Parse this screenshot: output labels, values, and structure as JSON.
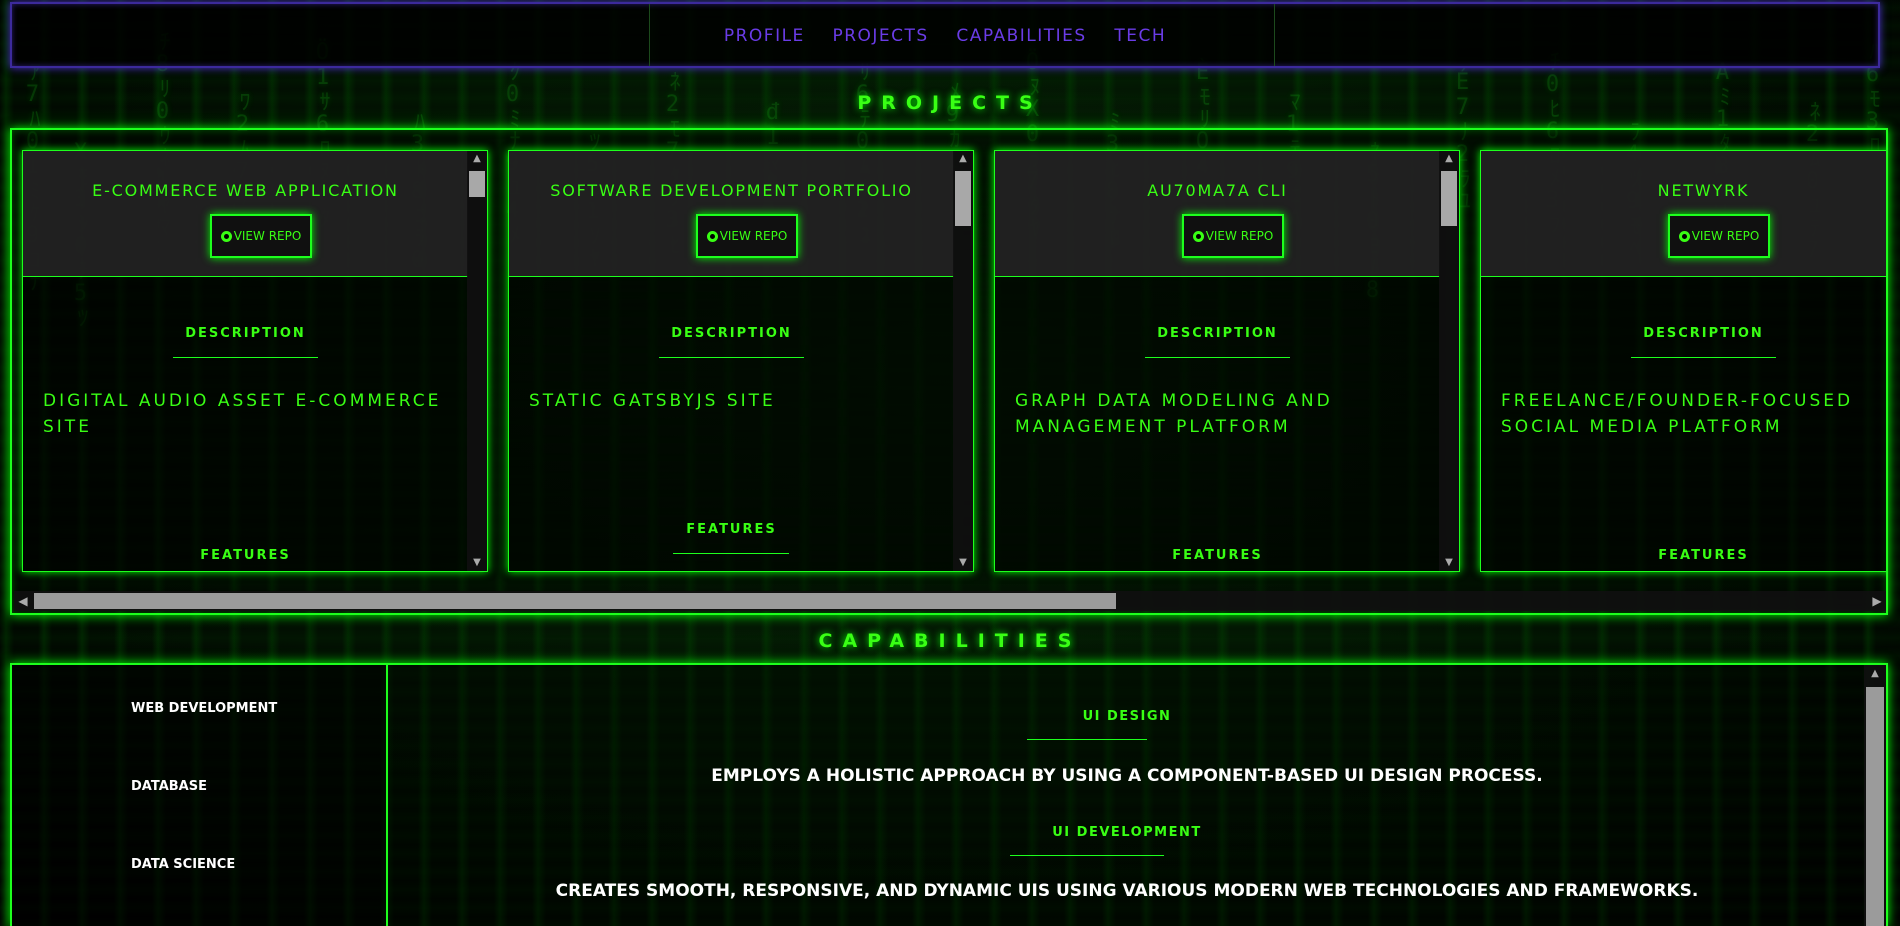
{
  "nav": {
    "links": [
      "PROFILE",
      "PROJECTS",
      "CAPABILITIES",
      "TECH"
    ]
  },
  "sections": {
    "projects_title": "PROJECTS",
    "capabilities_title": "CAPABILITIES"
  },
  "projects": [
    {
      "title": "E-COMMERCE WEB APPLICATION",
      "repo_label": "VIEW REPO",
      "description_label": "DESCRIPTION",
      "description": "DIGITAL AUDIO ASSET E-COMMERCE SITE",
      "features_label": "FEATURES"
    },
    {
      "title": "SOFTWARE DEVELOPMENT PORTFOLIO",
      "repo_label": "VIEW REPO",
      "description_label": "DESCRIPTION",
      "description": "STATIC GATSBYJS SITE",
      "features_label": "FEATURES"
    },
    {
      "title": "AU70MA7A CLI",
      "repo_label": "VIEW REPO",
      "description_label": "DESCRIPTION",
      "description": "GRAPH DATA MODELING AND MANAGEMENT PLATFORM",
      "features_label": "FEATURES"
    },
    {
      "title": "NETWYRK",
      "repo_label": "VIEW REPO",
      "description_label": "DESCRIPTION",
      "description": "FREELANCE/FOUNDER-FOCUSED SOCIAL MEDIA PLATFORM",
      "features_label": "FEATURES"
    }
  ],
  "capabilities": {
    "categories": [
      "WEB DEVELOPMENT",
      "DATABASE",
      "DATA SCIENCE"
    ],
    "items": [
      {
        "heading": "UI DESIGN",
        "description": "EMPLOYS A HOLISTIC APPROACH BY USING A COMPONENT-BASED UI DESIGN PROCESS."
      },
      {
        "heading": "UI DEVELOPMENT",
        "description": "CREATES SMOOTH, RESPONSIVE, AND DYNAMIC UIS USING VARIOUS MODERN WEB TECHNOLOGIES AND FRAMEWORKS."
      }
    ]
  },
  "colors": {
    "accent": "#39ff14",
    "nav_link": "#6a3ce6",
    "nav_border": "#3c2a9c",
    "card_head_bg": "#232323"
  },
  "icons": {
    "repo_button": "github-icon"
  }
}
